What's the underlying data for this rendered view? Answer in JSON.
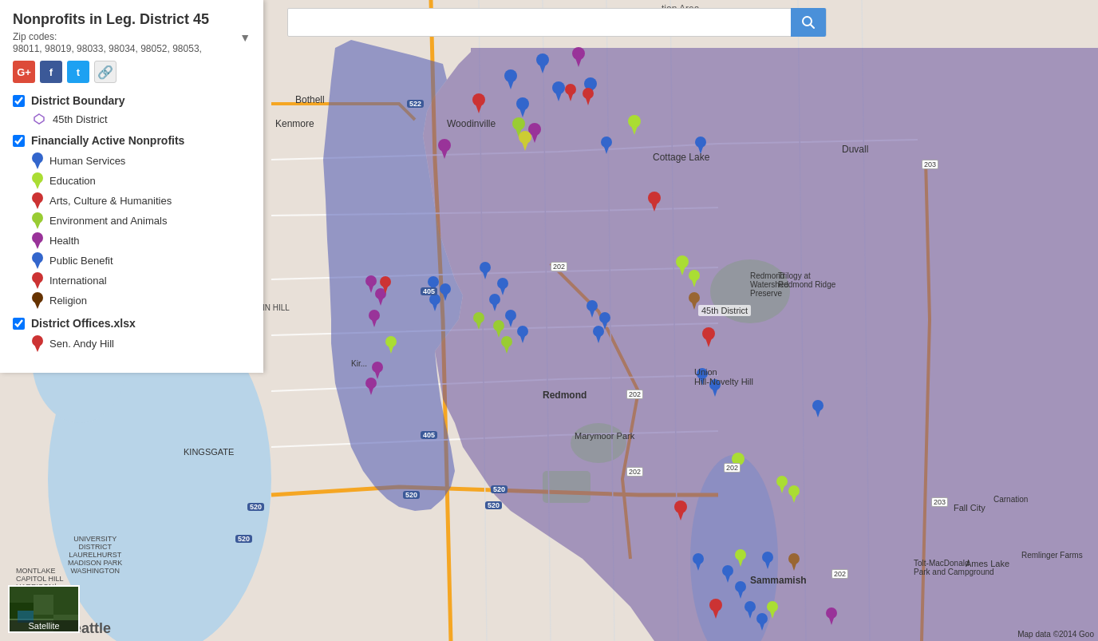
{
  "title": "Nonprofits in Leg. District 45",
  "zipcodes_label": "Zip codes:",
  "zipcodes": "98011, 98019, 98033, 98034, 98052, 98053,",
  "social": {
    "gplus": "G+",
    "facebook": "f",
    "twitter": "t",
    "share": "share"
  },
  "district_boundary": {
    "label": "District Boundary",
    "item": "45th District"
  },
  "financially_active": {
    "label": "Financially Active Nonprofits",
    "categories": [
      {
        "name": "Human Services",
        "color": "#3366cc"
      },
      {
        "name": "Education",
        "color": "#99cc33"
      },
      {
        "name": "Arts, Culture & Humanities",
        "color": "#cc3333"
      },
      {
        "name": "Environment and Animals",
        "color": "#99cc33"
      },
      {
        "name": "Health",
        "color": "#993399"
      },
      {
        "name": "Public Benefit",
        "color": "#3366cc"
      },
      {
        "name": "International",
        "color": "#cc3333"
      },
      {
        "name": "Religion",
        "color": "#663300"
      }
    ]
  },
  "district_offices": {
    "label": "District Offices.xlsx",
    "items": [
      {
        "name": "Sen. Andy Hill",
        "color": "#cc3333"
      }
    ]
  },
  "search": {
    "placeholder": "",
    "button_label": "🔍"
  },
  "satellite": {
    "label": "Satellite"
  },
  "map_labels": {
    "district_45": "45th District",
    "search_area": "tion Area"
  },
  "attribution": "Map data ©2014 Goo",
  "colors": {
    "purple_overlay": "rgba(100, 80, 160, 0.55)",
    "blue_dark": "#3366cc",
    "red": "#cc3333",
    "green_yellow": "#99cc33",
    "purple": "#993399",
    "brown": "#663300"
  }
}
